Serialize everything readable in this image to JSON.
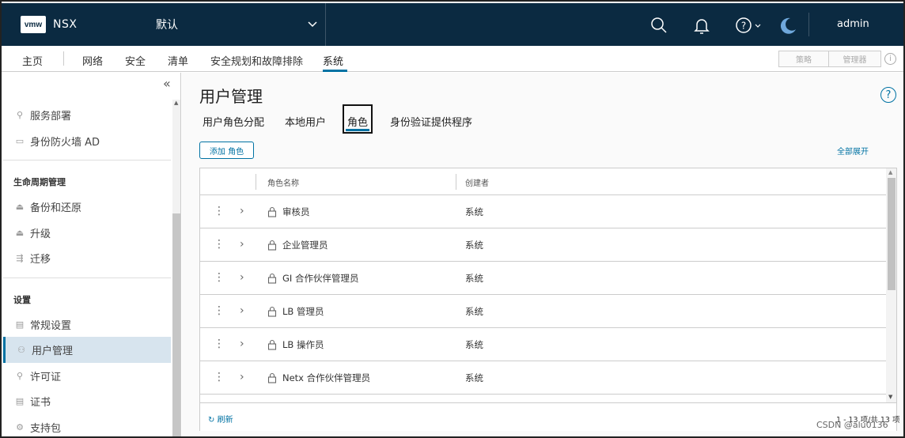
{
  "header": {
    "logo": "vmw",
    "product": "NSX",
    "tenant": "默认",
    "user": "admin"
  },
  "nav": {
    "items": [
      "主页",
      "网络",
      "安全",
      "清单",
      "安全规划和故障排除",
      "系统"
    ],
    "active": "系统",
    "mode_policy": "策略",
    "mode_manager": "管理器"
  },
  "sidebar": {
    "group1": [
      {
        "label": "服务部署",
        "icon": "service-deploy-icon"
      },
      {
        "label": "身份防火墙 AD",
        "icon": "folder-icon"
      }
    ],
    "lifecycle_heading": "生命周期管理",
    "lifecycle": [
      {
        "label": "备份和还原",
        "icon": "backup-icon"
      },
      {
        "label": "升级",
        "icon": "upgrade-icon"
      },
      {
        "label": "迁移",
        "icon": "migrate-icon"
      }
    ],
    "settings_heading": "设置",
    "settings": [
      {
        "label": "常规设置",
        "icon": "settings-doc-icon"
      },
      {
        "label": "用户管理",
        "icon": "users-icon",
        "active": true
      },
      {
        "label": "许可证",
        "icon": "license-icon"
      },
      {
        "label": "证书",
        "icon": "certificate-icon"
      },
      {
        "label": "支持包",
        "icon": "support-bundle-icon"
      }
    ]
  },
  "page": {
    "title": "用户管理",
    "tabs": [
      "用户角色分配",
      "本地用户",
      "角色",
      "身份验证提供程序"
    ],
    "active_tab": "角色",
    "add_button": "添加 角色",
    "expand_all": "全部展开"
  },
  "grid": {
    "columns": [
      "角色名称",
      "创建者"
    ],
    "rows": [
      {
        "name": "审核员",
        "creator": "系统"
      },
      {
        "name": "企业管理员",
        "creator": "系统"
      },
      {
        "name": "GI 合作伙伴管理员",
        "creator": "系统"
      },
      {
        "name": "LB 管理员",
        "creator": "系统"
      },
      {
        "name": "LB 操作员",
        "creator": "系统"
      },
      {
        "name": "Netx 合作伙伴管理员",
        "creator": "系统"
      }
    ],
    "refresh": "刷新",
    "pager": "1 - 13 项/共 13 项"
  },
  "watermark": "CSDN @alu0136",
  "colors": {
    "topbar": "#0b2a41",
    "accent": "#0072a3",
    "active_sidebar": "#d7e4ee"
  }
}
